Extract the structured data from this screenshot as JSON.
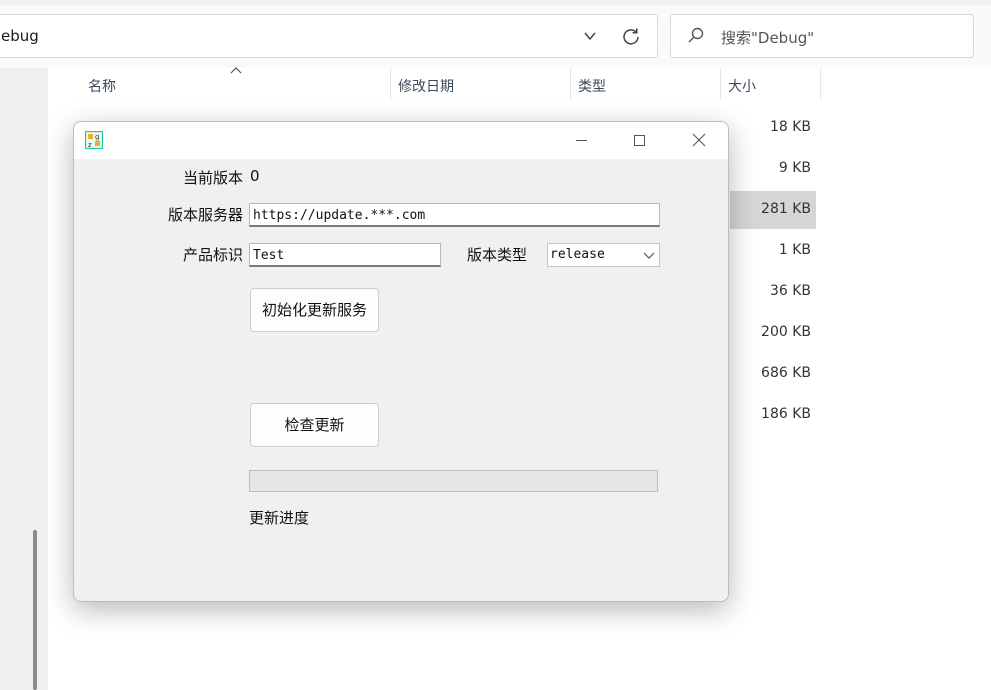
{
  "explorer": {
    "address_text": "ebug",
    "search_placeholder": "搜索\"Debug\"",
    "columns": {
      "name": "名称",
      "modified": "修改日期",
      "type": "类型",
      "size": "大小"
    },
    "sizes": [
      "18 KB",
      "9 KB",
      "281 KB",
      "1 KB",
      "36 KB",
      "200 KB",
      "686 KB",
      "186 KB"
    ],
    "selected_row_index": 2
  },
  "dialog": {
    "fields": {
      "current_version_label": "当前版本",
      "current_version_value": "0",
      "server_label": "版本服务器",
      "server_value": "https://update.***.com",
      "product_label": "产品标识",
      "product_value": "Test",
      "version_type_label": "版本类型",
      "version_type_value": "release"
    },
    "buttons": {
      "init": "初始化更新服务",
      "check": "检查更新"
    },
    "progress": {
      "value": 0,
      "label": "更新进度"
    }
  }
}
